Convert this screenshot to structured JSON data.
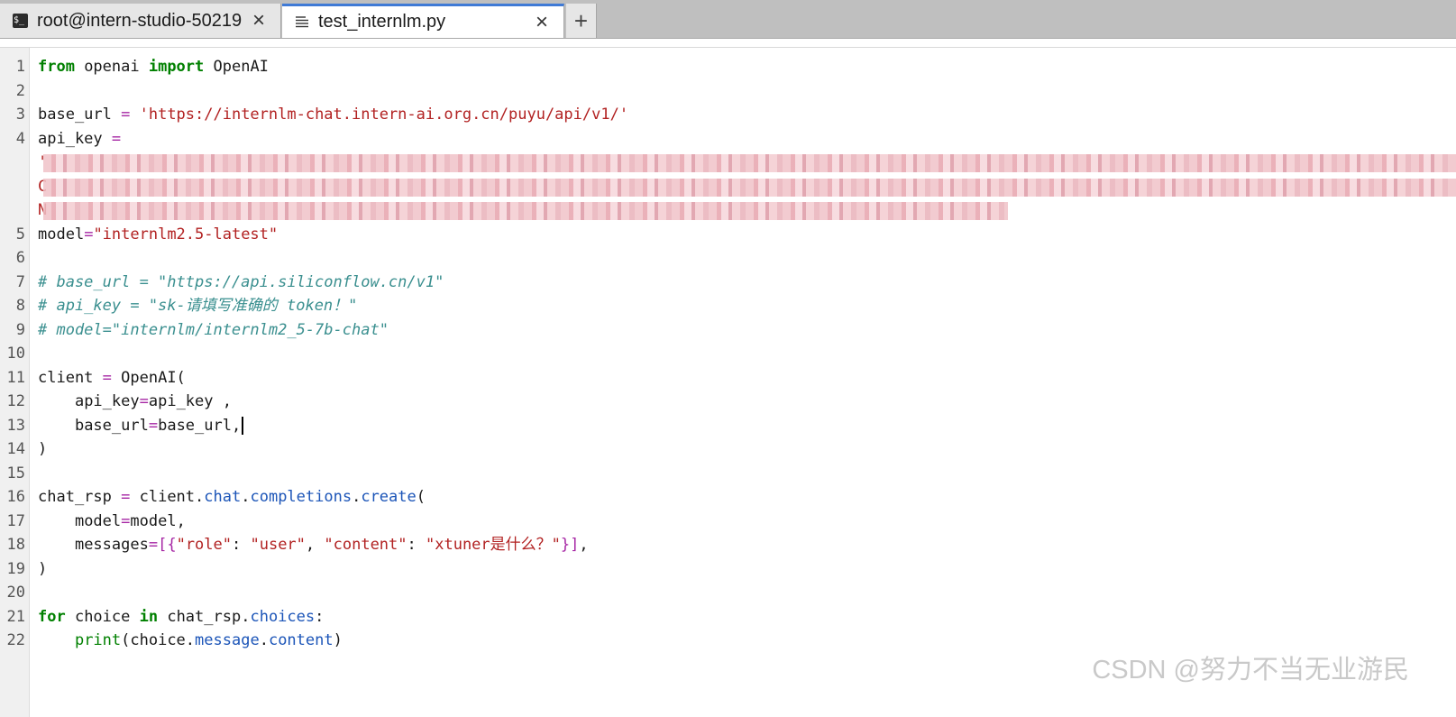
{
  "tabs": [
    {
      "label": "root@intern-studio-50219",
      "icon": "terminal-icon",
      "close": "×"
    },
    {
      "label": "test_internlm.py",
      "icon": "document-icon",
      "close": "×"
    }
  ],
  "new_tab_label": "+",
  "line_numbers": [
    "1",
    "2",
    "3",
    "4",
    "",
    "",
    "",
    "5",
    "6",
    "7",
    "8",
    "9",
    "10",
    "11",
    "12",
    "13",
    "14",
    "15",
    "16",
    "17",
    "18",
    "19",
    "20",
    "21",
    "22"
  ],
  "code": {
    "l1": {
      "kw1": "from",
      "mod": " openai ",
      "kw2": "import",
      "cls": " OpenAI"
    },
    "l3": {
      "name": "base_url ",
      "op": "=",
      "val": " 'https://internlm-chat.intern-ai.org.cn/puyu/api/v1/'"
    },
    "l4": {
      "name": "api_key ",
      "op": "="
    },
    "l4_wrap": [
      "'",
      "C",
      "N"
    ],
    "l5": {
      "name": "model",
      "op": "=",
      "val": "\"internlm2.5-latest\""
    },
    "l7": "# base_url = \"https://api.siliconflow.cn/v1\"",
    "l8": "# api_key = \"sk-请填写准确的 token！\"",
    "l9": "# model=\"internlm/internlm2_5-7b-chat\"",
    "l11": {
      "name": "client ",
      "op": "=",
      "rest": " OpenAI("
    },
    "l12": {
      "indent": "    ",
      "name": "api_key",
      "op": "=",
      "rest": "api_key ,"
    },
    "l13": {
      "indent": "    ",
      "name": "base_url",
      "op": "=",
      "rest": "base_url,"
    },
    "l14": ")",
    "l16": {
      "name": "chat_rsp ",
      "op": "=",
      "obj": " client",
      "dot1": ".",
      "a1": "chat",
      "dot2": ".",
      "a2": "completions",
      "dot3": ".",
      "a3": "create",
      "paren": "("
    },
    "l17": {
      "indent": "    ",
      "name": "model",
      "op": "=",
      "rest": "model,"
    },
    "l18": {
      "indent": "    ",
      "name": "messages",
      "op": "=",
      "br": "[{",
      "k1": "\"role\"",
      "c1": ": ",
      "v1": "\"user\"",
      "sep": ", ",
      "k2": "\"content\"",
      "c2": ": ",
      "v2": "\"xtuner是什么？\"",
      "br2": "}]",
      "end": ","
    },
    "l19": ")",
    "l21": {
      "kw1": "for",
      "v": " choice ",
      "kw2": "in",
      "obj": " chat_rsp",
      "dot": ".",
      "attr": "choices",
      "end": ":"
    },
    "l22": {
      "indent": "    ",
      "fn": "print",
      "p1": "(choice",
      "dot1": ".",
      "a1": "message",
      "dot2": ".",
      "a2": "content",
      "p2": ")"
    }
  },
  "watermark": "CSDN @努力不当无业游民"
}
